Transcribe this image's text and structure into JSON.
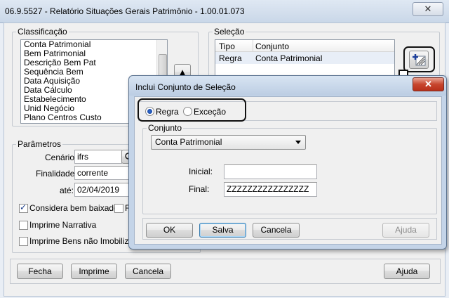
{
  "window": {
    "title": "06.9.5527 - Relatório Situações Gerais Patrimônio - 1.00.01.073",
    "close_glyph": "✕"
  },
  "classificacao": {
    "legend": "Classificação",
    "items": [
      "Conta Patrimonial",
      "Bem Patrimonial",
      "Descrição Bem Pat",
      "Sequência Bem",
      "Data Aquisição",
      "Data Cálculo",
      "Estabelecimento",
      "Unid Negócio",
      "Plano Centros Custo"
    ],
    "move_up_glyph": "▲"
  },
  "selecao": {
    "legend": "Seleção",
    "columns": [
      "Tipo",
      "Conjunto"
    ],
    "rows": [
      {
        "tipo": "Regra",
        "conjunto": "Conta Patrimonial"
      }
    ]
  },
  "parametros": {
    "legend": "Parâmetros",
    "cenario_label": "Cenário:",
    "cenario_value": "ifrs",
    "finalidade_label": "Finalidade:",
    "finalidade_value": "corrente",
    "ate_label": "até:",
    "ate_value": "02/04/2019",
    "considera_label": "Considera bem baixado",
    "considera_checked": true,
    "partial_label": "R",
    "imprime_narrativa_label": "Imprime Narrativa",
    "imprime_narrativa_checked": false,
    "imprime_bens_label": "Imprime Bens não Imobilizados",
    "imprime_bens_checked": false
  },
  "footer": {
    "fecha": "Fecha",
    "imprime": "Imprime",
    "cancela": "Cancela",
    "ajuda": "Ajuda"
  },
  "dialog": {
    "title": "Inclui Conjunto de Seleção",
    "close_glyph": "✕",
    "regra_label": "Regra",
    "excecao_label": "Exceção",
    "selected": "Regra",
    "conjunto_legend": "Conjunto",
    "conjunto_value": "Conta Patrimonial",
    "inicial_label": "Inicial:",
    "inicial_value": "",
    "final_label": "Final:",
    "final_value": "ZZZZZZZZZZZZZZZZ",
    "ok": "OK",
    "salva": "Salva",
    "cancela": "Cancela",
    "ajuda": "Ajuda"
  },
  "colors": {
    "highlight": "#111111",
    "radio_selected": "#2c6bd5",
    "close_red": "#c7452d"
  },
  "icons": {
    "add_selection": "add-selection-icon",
    "pointer_arrow": "down-arrow-icon"
  }
}
